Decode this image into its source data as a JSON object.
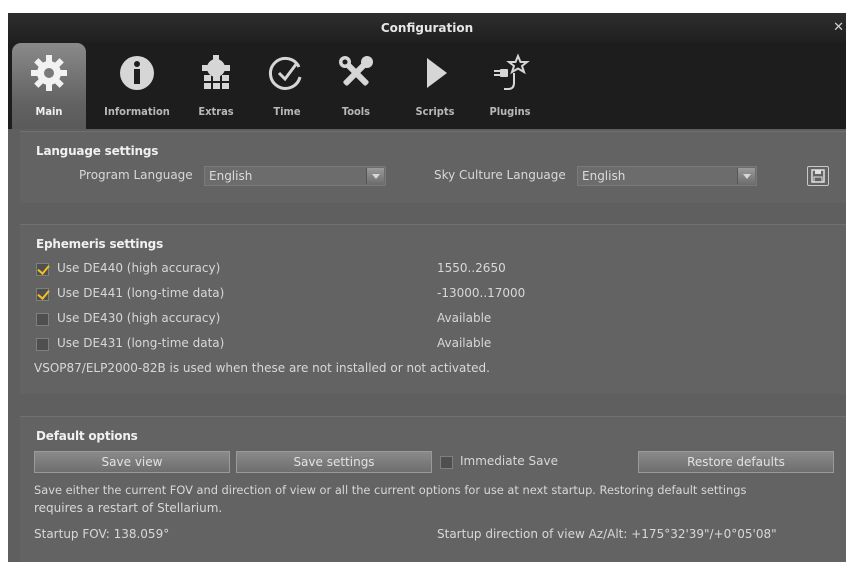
{
  "window": {
    "title": "Configuration",
    "close_glyph": "✕"
  },
  "tabs": [
    {
      "label": "Main",
      "icon": "gear-icon"
    },
    {
      "label": "Information",
      "icon": "info-icon"
    },
    {
      "label": "Extras",
      "icon": "gear-grid-icon"
    },
    {
      "label": "Time",
      "icon": "clock-icon"
    },
    {
      "label": "Tools",
      "icon": "tools-icon"
    },
    {
      "label": "Scripts",
      "icon": "play-icon"
    },
    {
      "label": "Plugins",
      "icon": "plugin-icon"
    }
  ],
  "language": {
    "title": "Language settings",
    "program_label": "Program Language",
    "program_value": "English",
    "sky_label": "Sky Culture Language",
    "sky_value": "English",
    "save_icon": "floppy-icon"
  },
  "ephemeris": {
    "title": "Ephemeris settings",
    "items": [
      {
        "label": "Use DE440 (high accuracy)",
        "checked": true,
        "range": "1550..2650"
      },
      {
        "label": "Use DE441 (long-time data)",
        "checked": true,
        "range": "-13000..17000"
      },
      {
        "label": "Use DE430 (high accuracy)",
        "checked": false,
        "range": "Available"
      },
      {
        "label": "Use DE431 (long-time data)",
        "checked": false,
        "range": "Available"
      }
    ],
    "note": "VSOP87/ELP2000-82B is used when these are not installed or not activated."
  },
  "defaults": {
    "title": "Default options",
    "save_view": "Save view",
    "save_settings": "Save settings",
    "immediate_save": "Immediate Save",
    "restore": "Restore defaults",
    "description_line1": "Save either the current FOV and direction of view or all the current options for use at next startup. Restoring default settings",
    "description_line2": "requires a restart of Stellarium.",
    "startup_fov": "Startup FOV: 138.059°",
    "startup_dir": "Startup direction of view Az/Alt: +175°32'39\"/+0°05'08\""
  },
  "colors": {
    "check": "#f0c020",
    "panel": "#636363",
    "toolbar": "#1d1d1d"
  }
}
